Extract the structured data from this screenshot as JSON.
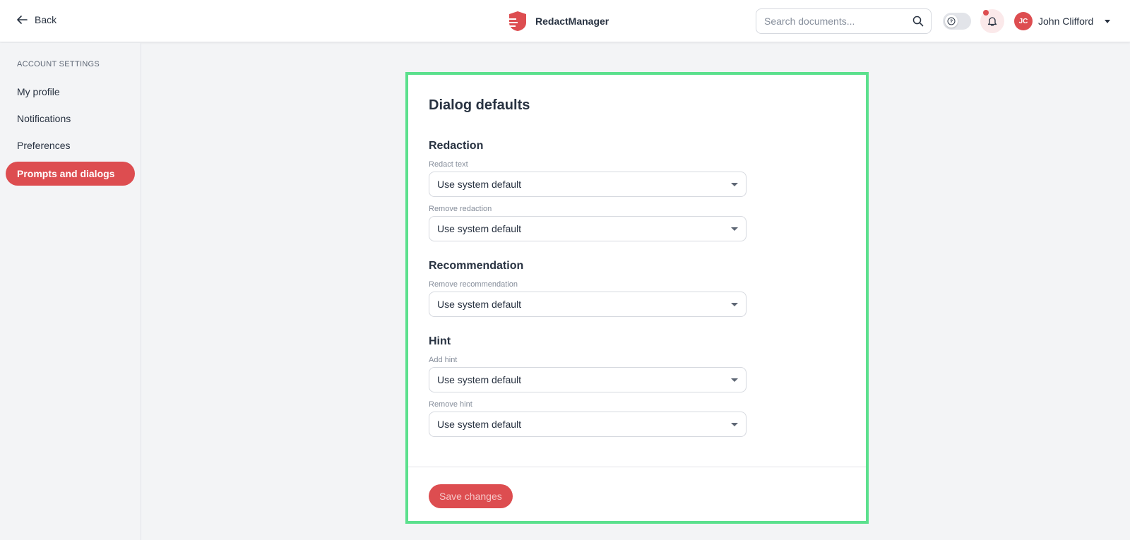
{
  "header": {
    "back_label": "Back",
    "brand_name": "RedactManager",
    "search_placeholder": "Search documents...",
    "user_initials": "JC",
    "user_name": "John Clifford",
    "notification_dot": true
  },
  "sidebar": {
    "title": "Account Settings",
    "items": [
      {
        "label": "My profile",
        "active": false
      },
      {
        "label": "Notifications",
        "active": false
      },
      {
        "label": "Preferences",
        "active": false
      },
      {
        "label": "Prompts and dialogs",
        "active": true
      }
    ]
  },
  "main": {
    "title": "Dialog defaults",
    "sections": [
      {
        "title": "Redaction",
        "fields": [
          {
            "label": "Redact text",
            "value": "Use system default"
          },
          {
            "label": "Remove redaction",
            "value": "Use system default"
          }
        ]
      },
      {
        "title": "Recommendation",
        "fields": [
          {
            "label": "Remove recommendation",
            "value": "Use system default"
          }
        ]
      },
      {
        "title": "Hint",
        "fields": [
          {
            "label": "Add hint",
            "value": "Use system default"
          },
          {
            "label": "Remove hint",
            "value": "Use system default"
          }
        ]
      }
    ],
    "save_label": "Save changes"
  },
  "colors": {
    "accent": "#dd4d50",
    "highlight_border": "#5be08d",
    "background": "#f3f4f6",
    "text": "#283241"
  }
}
